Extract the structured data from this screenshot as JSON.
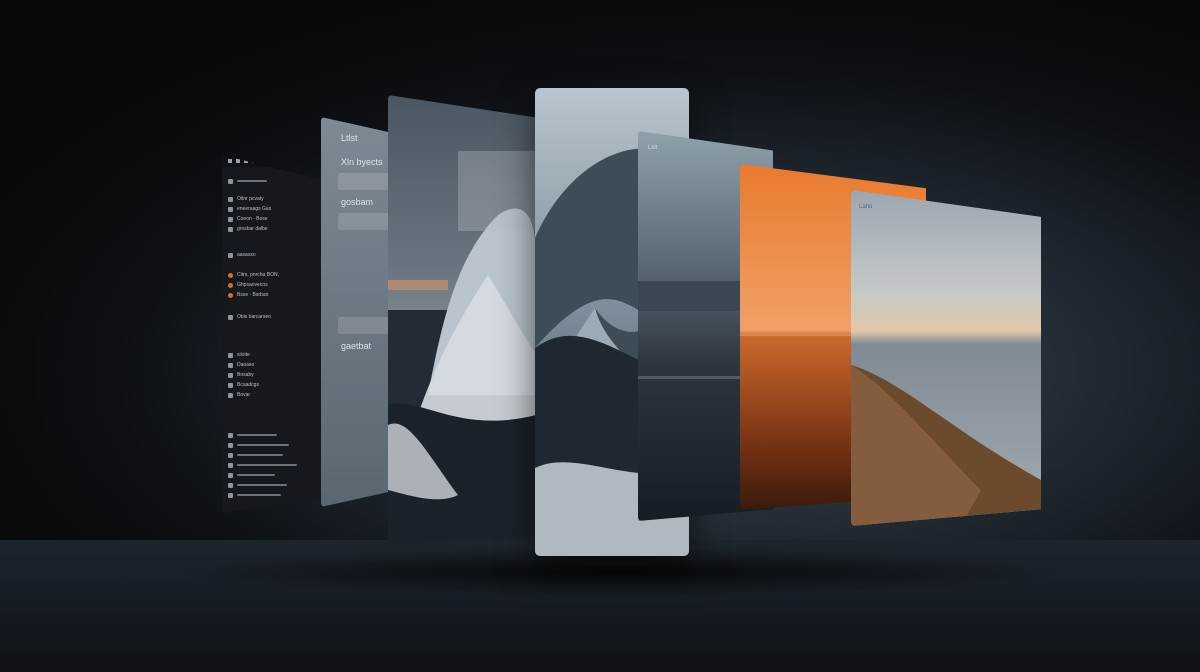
{
  "panels": {
    "list_panel": {
      "title": "Ltlst",
      "row_1": "Xln byects",
      "row_2": "gosbam",
      "row_3": "gaetbat"
    },
    "sea_panel": {
      "label": "Lkit"
    },
    "cliff_panel": {
      "label": "Lano"
    },
    "app_panel": {
      "rows": [
        "Oitnr pcvaty",
        "eneeraags Gas",
        "Coeon · Bose",
        "grosbar dalbe",
        "aasasso",
        "Citrs, pnrcha BON,",
        "Ghpsaovecos",
        "Bsse · Bsrban",
        "Obis barcarseo",
        "siioite",
        "Daoaso",
        "Bosaby",
        "Bcaadcgs",
        "Bovar"
      ]
    }
  },
  "colors": {
    "accent_orange": "#e06a24",
    "panel_dark": "#15191e"
  }
}
